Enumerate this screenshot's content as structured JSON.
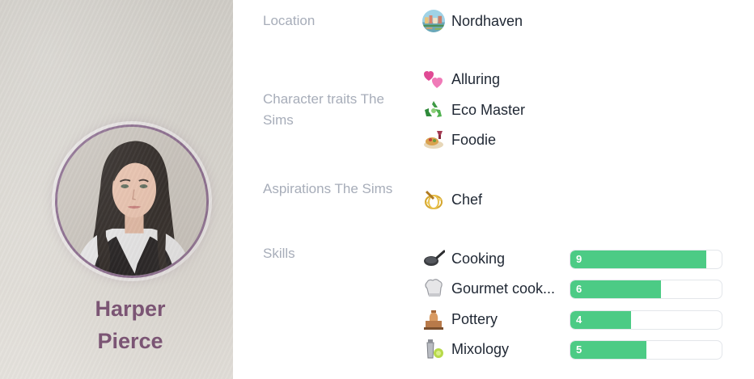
{
  "profile": {
    "name_line1": "Harper",
    "name_line2": "Pierce",
    "accent_color": "#7b5574"
  },
  "labels": {
    "location": "Location",
    "traits": "Character traits The Sims",
    "aspirations": "Aspirations The Sims",
    "skills": "Skills"
  },
  "location": {
    "name": "Nordhaven",
    "icon": "town-icon"
  },
  "traits": [
    {
      "label": "Alluring",
      "icon": "hearts-icon"
    },
    {
      "label": "Eco Master",
      "icon": "recycle-icon"
    },
    {
      "label": "Foodie",
      "icon": "food-plate-icon"
    }
  ],
  "aspirations": [
    {
      "label": "Chef",
      "icon": "whisk-icon"
    }
  ],
  "skills": [
    {
      "label": "Cooking",
      "level": 9,
      "max": 10,
      "icon": "frying-pan-icon"
    },
    {
      "label": "Gourmet cook...",
      "level": 6,
      "max": 10,
      "icon": "chef-hat-icon"
    },
    {
      "label": "Pottery",
      "level": 4,
      "max": 10,
      "icon": "pottery-wheel-icon"
    },
    {
      "label": "Mixology",
      "level": 5,
      "max": 10,
      "icon": "cocktail-shaker-icon"
    }
  ],
  "colors": {
    "skill_bar": "#4ccb85",
    "label": "#a7adb9",
    "text": "#1f2733"
  }
}
